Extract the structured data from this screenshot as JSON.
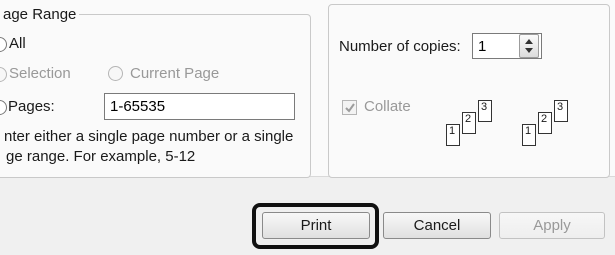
{
  "page_range": {
    "legend": "age Range",
    "all_label": "All",
    "selection_label": "Selection",
    "current_page_label": "Current Page",
    "pages_label": "Pages:",
    "pages_value": "1-65535",
    "hint_line1": "nter either a single page number or a single",
    "hint_line2": "ge range.  For example, 5-12"
  },
  "copies": {
    "number_label": "Number of copies:",
    "number_value": "1",
    "collate_label": "Collate",
    "collate_checked": true,
    "collate_icon_pages": [
      "1",
      "2",
      "3"
    ]
  },
  "buttons": {
    "print": "Print",
    "cancel": "Cancel",
    "apply": "Apply"
  },
  "colors": {
    "highlight": "#111111",
    "disabled_text": "#999999"
  }
}
